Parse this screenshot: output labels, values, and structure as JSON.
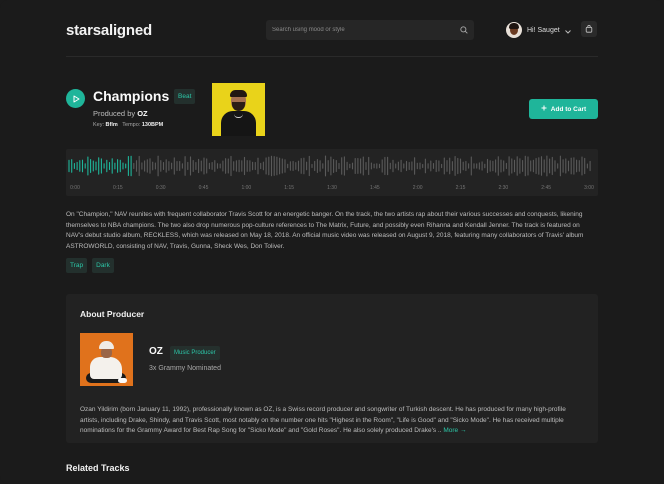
{
  "header": {
    "logo": "starsaligned",
    "search_placeholder": "Search using mood or style",
    "user_name": "Hi! Sauget"
  },
  "track": {
    "title": "Champions",
    "type_badge": "Beat",
    "produced_prefix": "Produced by",
    "producer": "OZ",
    "key_label": "Key:",
    "key_value": "Bflm",
    "tempo_label": "Tempo:",
    "tempo_value": "130BPM",
    "add_to_cart": "Add to Cart",
    "progress_fraction": 0.12,
    "description": "On \"Champion,\" NAV reunites with frequent collaborator Travis Scott for an energetic banger. On the track, the two artists rap about their various successes and conquests, likening themselves to NBA champions. The two also drop numerous pop-culture references to The Matrix, Future, and possibly even Rihanna and Kendall Jenner. The track is featured on NAV's debut studio album, RECKLESS, which was released on May 18, 2018. An official music video was released on August 9, 2018, featuring many collaborators of Travis' album ASTROWORLD, consisting of NAV, Travis, Gunna, Sheck Wes, Don Toliver.",
    "tags": [
      "Trap",
      "Dark"
    ]
  },
  "waveform": {
    "time_labels": [
      "0:00",
      "0:15",
      "0:30",
      "0:45",
      "1:00",
      "1:15",
      "1:30",
      "1:45",
      "2:00",
      "2:15",
      "2:30",
      "2:45",
      "3:00"
    ],
    "played_color": "#1fb59a",
    "unplayed_color": "#5a5a5a"
  },
  "producer": {
    "section_title": "About Producer",
    "name": "OZ",
    "role_badge": "Music Producer",
    "awards": "3x Grammy Nominated",
    "bio": "Ozan Yildirim (born January 11, 1992), professionally known as OZ, is a Swiss record producer and songwriter of Turkish descent. He has produced for many high-profile artists, including Drake, Shindy, and Travis Scott, most notably on the number one hits \"Highest in the Room\", \"Life is Good\" and \"Sicko Mode\". He has received multiple nominations for the Grammy Award for Best Rap Song for \"Sicko Mode\" and \"Gold Roses\". He also solely produced Drake's ..",
    "more_link": "More →"
  },
  "related": {
    "title": "Related Tracks"
  },
  "colors": {
    "accent": "#1fb59a",
    "background": "#1b1b1b",
    "panel": "#222222"
  }
}
